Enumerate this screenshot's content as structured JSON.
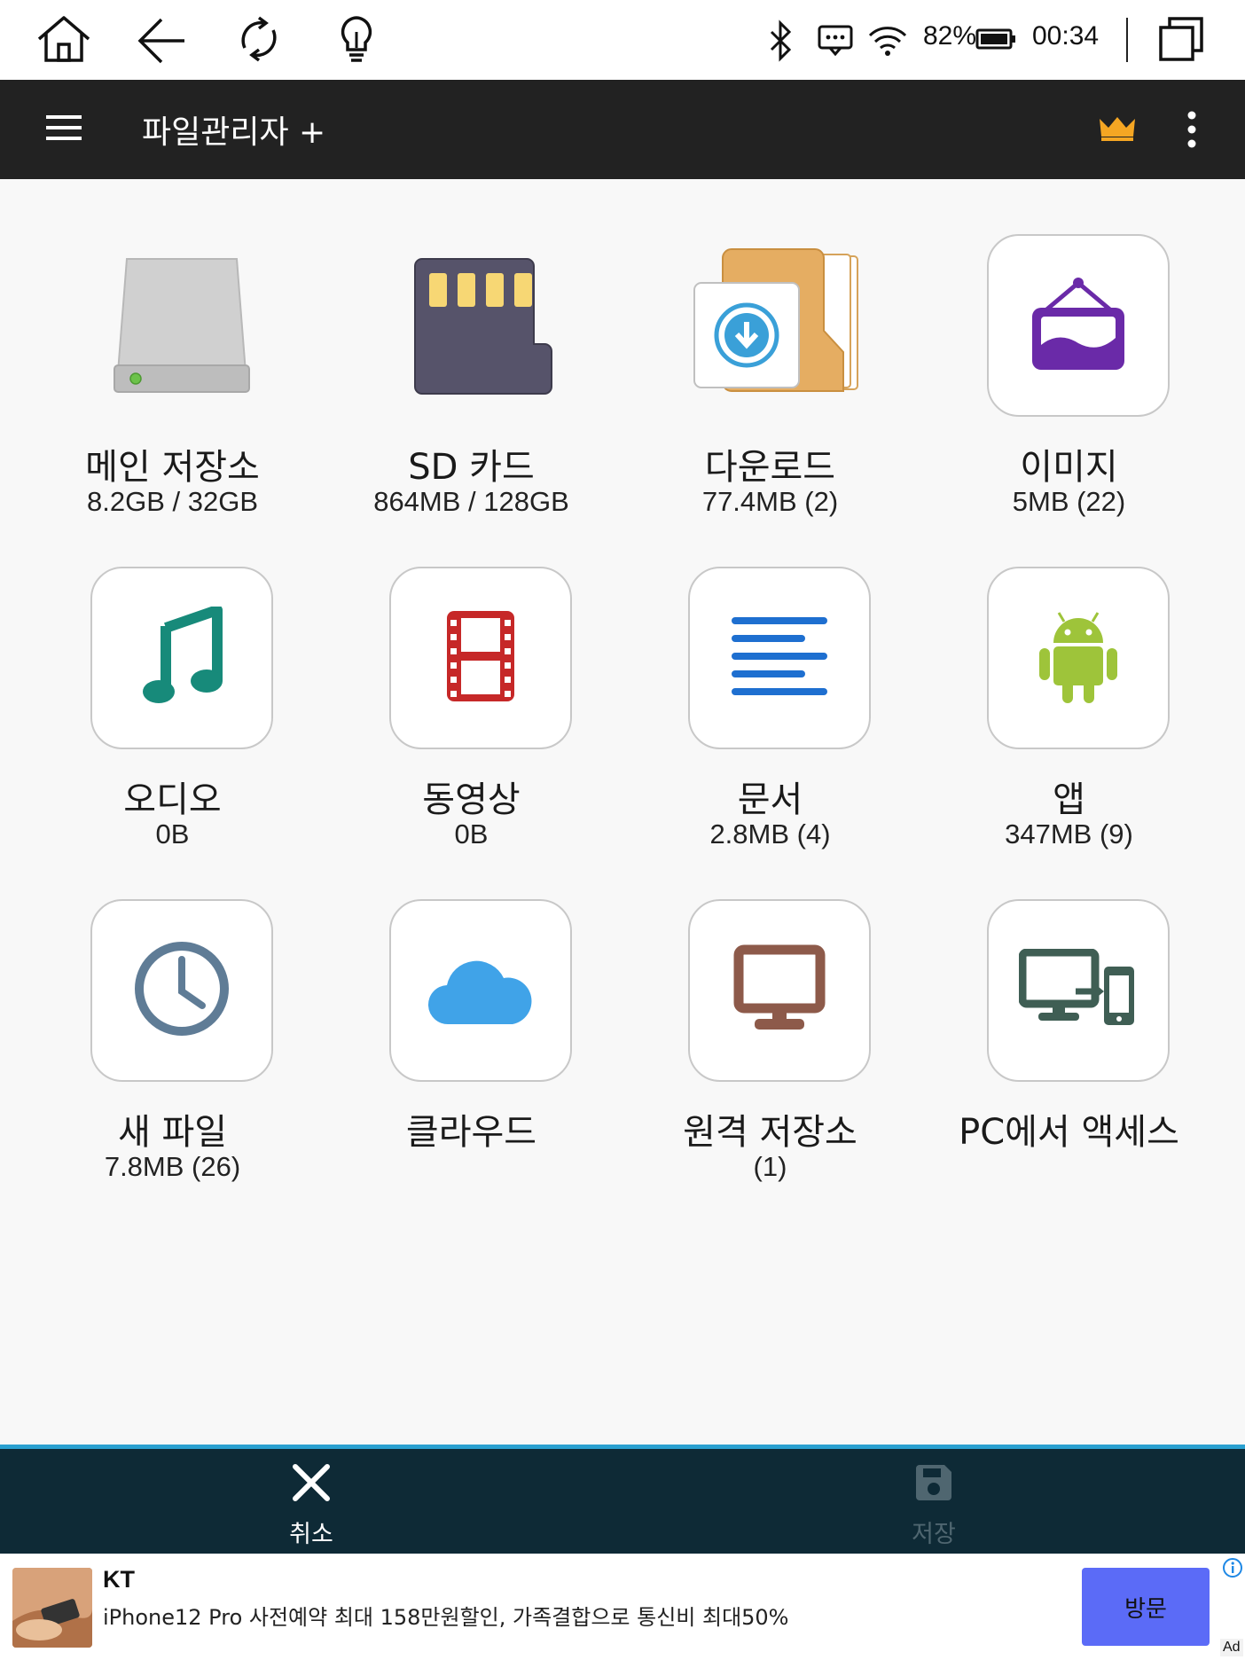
{
  "status_bar": {
    "battery_percent": "82%",
    "time": "00:34",
    "icons": [
      "home-icon",
      "back-icon",
      "refresh-icon",
      "lightbulb-icon",
      "bluetooth-icon",
      "message-icon",
      "wifi-icon",
      "battery-icon",
      "window-icon"
    ]
  },
  "toolbar": {
    "title": "파일관리자 +",
    "menu_icon": "hamburger-menu-icon",
    "premium_icon": "crown-icon",
    "more_icon": "more-vert-icon",
    "crown_color": "#f5a623"
  },
  "tiles": [
    {
      "label": "메인 저장소",
      "sub": "8.2GB / 32GB",
      "icon": "hard-drive-icon"
    },
    {
      "label": "SD 카드",
      "sub": "864MB / 128GB",
      "icon": "sd-card-icon"
    },
    {
      "label": "다운로드",
      "sub": "77.4MB (2)",
      "icon": "download-folder-icon"
    },
    {
      "label": "이미지",
      "sub": "5MB (22)",
      "icon": "image-frame-icon"
    },
    {
      "label": "오디오",
      "sub": "0B",
      "icon": "music-note-icon"
    },
    {
      "label": "동영상",
      "sub": "0B",
      "icon": "film-icon"
    },
    {
      "label": "문서",
      "sub": "2.8MB (4)",
      "icon": "document-lines-icon"
    },
    {
      "label": "앱",
      "sub": "347MB (9)",
      "icon": "android-icon"
    },
    {
      "label": "새 파일",
      "sub": "7.8MB (26)",
      "icon": "clock-icon"
    },
    {
      "label": "클라우드",
      "sub": "",
      "icon": "cloud-icon"
    },
    {
      "label": "원격 저장소",
      "sub": "(1)",
      "icon": "monitor-icon"
    },
    {
      "label": "PC에서 액세스",
      "sub": "",
      "icon": "pc-to-phone-icon"
    }
  ],
  "action_bar": {
    "cancel_label": "취소",
    "save_label": "저장",
    "cancel_icon": "close-icon",
    "save_icon": "save-disk-icon"
  },
  "ad": {
    "brand": "KT",
    "text": "iPhone12 Pro 사전예약 최대 158만원할인, 가족결합으로 통신비 최대50%",
    "button_label": "방문",
    "ad_mark": "Ad",
    "button_color": "#5b6bf7"
  }
}
